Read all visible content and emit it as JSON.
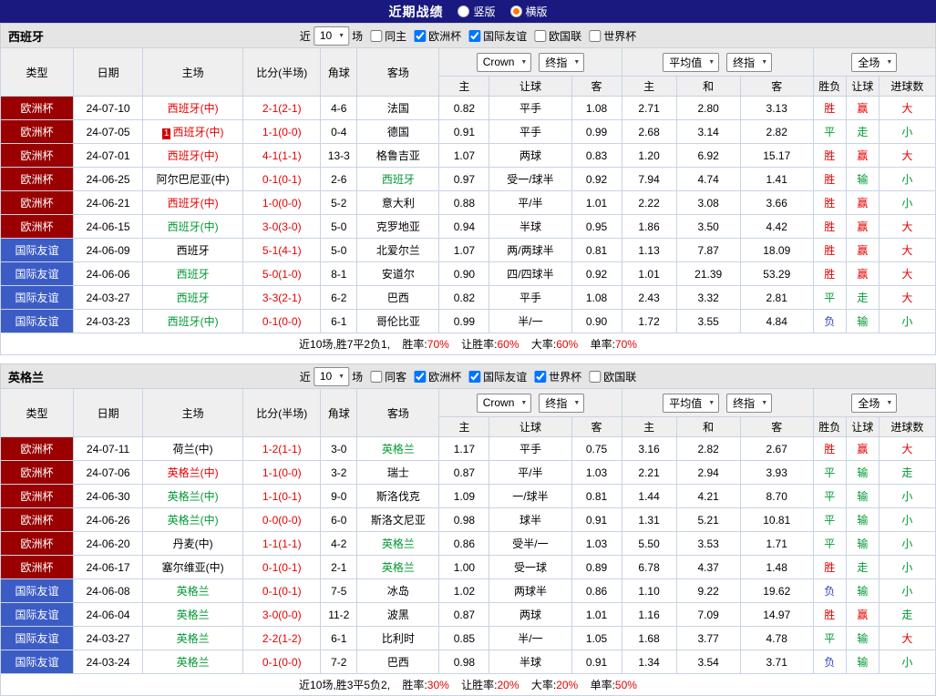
{
  "topbar": {
    "title": "近期战绩",
    "options": [
      {
        "label": "竖版",
        "selected": false
      },
      {
        "label": "横版",
        "selected": true
      }
    ]
  },
  "palette": {
    "euro_bg": "#9a0000",
    "friendly_bg": "#3c5cc5",
    "red": "#e60000",
    "green": "#009933",
    "blue": "#3344cc"
  },
  "table_header": {
    "cols": [
      "类型",
      "日期",
      "主场",
      "比分(半场)",
      "角球",
      "客场"
    ],
    "odds_selects": [
      "Crown",
      "终指"
    ],
    "avg_selects": [
      "平均值",
      "终指"
    ],
    "result_select": "全场",
    "sub": [
      "主",
      "让球",
      "客",
      "主",
      "和",
      "客",
      "胜负",
      "让球",
      "进球数"
    ]
  },
  "sections": [
    {
      "team": "西班牙",
      "filter": {
        "near": "近",
        "count": "10",
        "games": "场",
        "same": {
          "label": "同主",
          "checked": false
        },
        "leagues": [
          {
            "label": "欧洲杯",
            "checked": true
          },
          {
            "label": "国际友谊",
            "checked": true
          },
          {
            "label": "欧国联",
            "checked": false
          },
          {
            "label": "世界杯",
            "checked": false
          }
        ]
      },
      "rows": [
        {
          "type": "欧洲杯",
          "date": "24-07-10",
          "home": "西班牙(中)",
          "home_color": "red",
          "badge": "",
          "score": "2-1(2-1)",
          "corner": "4-6",
          "away": "法国",
          "away_color": "black",
          "crow": [
            "0.82",
            "平手",
            "1.08"
          ],
          "avg": [
            "2.71",
            "2.80",
            "3.13"
          ],
          "result": [
            "胜",
            "赢",
            "大"
          ],
          "result_color": [
            "red",
            "red",
            "red"
          ]
        },
        {
          "type": "欧洲杯",
          "date": "24-07-05",
          "home": "西班牙(中)",
          "home_color": "red",
          "badge": "1",
          "score": "1-1(0-0)",
          "corner": "0-4",
          "away": "德国",
          "away_color": "black",
          "crow": [
            "0.91",
            "平手",
            "0.99"
          ],
          "avg": [
            "2.68",
            "3.14",
            "2.82"
          ],
          "result": [
            "平",
            "走",
            "小"
          ],
          "result_color": [
            "green",
            "green",
            "green"
          ]
        },
        {
          "type": "欧洲杯",
          "date": "24-07-01",
          "home": "西班牙(中)",
          "home_color": "red",
          "badge": "",
          "score": "4-1(1-1)",
          "corner": "13-3",
          "away": "格鲁吉亚",
          "away_color": "black",
          "crow": [
            "1.07",
            "两球",
            "0.83"
          ],
          "avg": [
            "1.20",
            "6.92",
            "15.17"
          ],
          "result": [
            "胜",
            "赢",
            "大"
          ],
          "result_color": [
            "red",
            "red",
            "red"
          ]
        },
        {
          "type": "欧洲杯",
          "date": "24-06-25",
          "home": "阿尔巴尼亚(中)",
          "home_color": "black",
          "badge": "",
          "score": "0-1(0-1)",
          "corner": "2-6",
          "away": "西班牙",
          "away_color": "green",
          "crow": [
            "0.97",
            "受一/球半",
            "0.92"
          ],
          "avg": [
            "7.94",
            "4.74",
            "1.41"
          ],
          "result": [
            "胜",
            "输",
            "小"
          ],
          "result_color": [
            "red",
            "green",
            "green"
          ]
        },
        {
          "type": "欧洲杯",
          "date": "24-06-21",
          "home": "西班牙(中)",
          "home_color": "red",
          "badge": "",
          "score": "1-0(0-0)",
          "corner": "5-2",
          "away": "意大利",
          "away_color": "black",
          "crow": [
            "0.88",
            "平/半",
            "1.01"
          ],
          "avg": [
            "2.22",
            "3.08",
            "3.66"
          ],
          "result": [
            "胜",
            "赢",
            "小"
          ],
          "result_color": [
            "red",
            "red",
            "green"
          ]
        },
        {
          "type": "欧洲杯",
          "date": "24-06-15",
          "home": "西班牙(中)",
          "home_color": "green",
          "badge": "",
          "score": "3-0(3-0)",
          "corner": "5-0",
          "away": "克罗地亚",
          "away_color": "black",
          "crow": [
            "0.94",
            "半球",
            "0.95"
          ],
          "avg": [
            "1.86",
            "3.50",
            "4.42"
          ],
          "result": [
            "胜",
            "赢",
            "大"
          ],
          "result_color": [
            "red",
            "red",
            "red"
          ]
        },
        {
          "type": "国际友谊",
          "date": "24-06-09",
          "home": "西班牙",
          "home_color": "black",
          "badge": "",
          "score": "5-1(4-1)",
          "corner": "5-0",
          "away": "北爱尔兰",
          "away_color": "black",
          "crow": [
            "1.07",
            "两/两球半",
            "0.81"
          ],
          "avg": [
            "1.13",
            "7.87",
            "18.09"
          ],
          "result": [
            "胜",
            "赢",
            "大"
          ],
          "result_color": [
            "red",
            "red",
            "red"
          ]
        },
        {
          "type": "国际友谊",
          "date": "24-06-06",
          "home": "西班牙",
          "home_color": "green",
          "badge": "",
          "score": "5-0(1-0)",
          "corner": "8-1",
          "away": "安道尔",
          "away_color": "black",
          "crow": [
            "0.90",
            "四/四球半",
            "0.92"
          ],
          "avg": [
            "1.01",
            "21.39",
            "53.29"
          ],
          "result": [
            "胜",
            "赢",
            "大"
          ],
          "result_color": [
            "red",
            "red",
            "red"
          ]
        },
        {
          "type": "国际友谊",
          "date": "24-03-27",
          "home": "西班牙",
          "home_color": "green",
          "badge": "",
          "score": "3-3(2-1)",
          "corner": "6-2",
          "away": "巴西",
          "away_color": "black",
          "crow": [
            "0.82",
            "平手",
            "1.08"
          ],
          "avg": [
            "2.43",
            "3.32",
            "2.81"
          ],
          "result": [
            "平",
            "走",
            "大"
          ],
          "result_color": [
            "green",
            "green",
            "red"
          ]
        },
        {
          "type": "国际友谊",
          "date": "24-03-23",
          "home": "西班牙(中)",
          "home_color": "green",
          "badge": "",
          "score": "0-1(0-0)",
          "corner": "6-1",
          "away": "哥伦比亚",
          "away_color": "black",
          "crow": [
            "0.99",
            "半/一",
            "0.90"
          ],
          "avg": [
            "1.72",
            "3.55",
            "4.84"
          ],
          "result": [
            "负",
            "输",
            "小"
          ],
          "result_color": [
            "blue",
            "green",
            "green"
          ]
        }
      ],
      "summary": {
        "prefix": "近10场,胜7平2负1,",
        "stats": [
          {
            "label": "胜率:",
            "value": "70%"
          },
          {
            "label": "让胜率:",
            "value": "60%"
          },
          {
            "label": "大率:",
            "value": "60%"
          },
          {
            "label": "单率:",
            "value": "70%"
          }
        ]
      }
    },
    {
      "team": "英格兰",
      "filter": {
        "near": "近",
        "count": "10",
        "games": "场",
        "same": {
          "label": "同客",
          "checked": false
        },
        "leagues": [
          {
            "label": "欧洲杯",
            "checked": true
          },
          {
            "label": "国际友谊",
            "checked": true
          },
          {
            "label": "世界杯",
            "checked": true
          },
          {
            "label": "欧国联",
            "checked": false
          }
        ]
      },
      "rows": [
        {
          "type": "欧洲杯",
          "date": "24-07-11",
          "home": "荷兰(中)",
          "home_color": "black",
          "badge": "",
          "score": "1-2(1-1)",
          "corner": "3-0",
          "away": "英格兰",
          "away_color": "green",
          "crow": [
            "1.17",
            "平手",
            "0.75"
          ],
          "avg": [
            "3.16",
            "2.82",
            "2.67"
          ],
          "result": [
            "胜",
            "赢",
            "大"
          ],
          "result_color": [
            "red",
            "red",
            "red"
          ]
        },
        {
          "type": "欧洲杯",
          "date": "24-07-06",
          "home": "英格兰(中)",
          "home_color": "red",
          "badge": "",
          "score": "1-1(0-0)",
          "corner": "3-2",
          "away": "瑞士",
          "away_color": "black",
          "crow": [
            "0.87",
            "平/半",
            "1.03"
          ],
          "avg": [
            "2.21",
            "2.94",
            "3.93"
          ],
          "result": [
            "平",
            "输",
            "走"
          ],
          "result_color": [
            "green",
            "green",
            "green"
          ]
        },
        {
          "type": "欧洲杯",
          "date": "24-06-30",
          "home": "英格兰(中)",
          "home_color": "green",
          "badge": "",
          "score": "1-1(0-1)",
          "corner": "9-0",
          "away": "斯洛伐克",
          "away_color": "black",
          "crow": [
            "1.09",
            "一/球半",
            "0.81"
          ],
          "avg": [
            "1.44",
            "4.21",
            "8.70"
          ],
          "result": [
            "平",
            "输",
            "小"
          ],
          "result_color": [
            "green",
            "green",
            "green"
          ]
        },
        {
          "type": "欧洲杯",
          "date": "24-06-26",
          "home": "英格兰(中)",
          "home_color": "green",
          "badge": "",
          "score": "0-0(0-0)",
          "corner": "6-0",
          "away": "斯洛文尼亚",
          "away_color": "black",
          "crow": [
            "0.98",
            "球半",
            "0.91"
          ],
          "avg": [
            "1.31",
            "5.21",
            "10.81"
          ],
          "result": [
            "平",
            "输",
            "小"
          ],
          "result_color": [
            "green",
            "green",
            "green"
          ]
        },
        {
          "type": "欧洲杯",
          "date": "24-06-20",
          "home": "丹麦(中)",
          "home_color": "black",
          "badge": "",
          "score": "1-1(1-1)",
          "corner": "4-2",
          "away": "英格兰",
          "away_color": "green",
          "crow": [
            "0.86",
            "受半/一",
            "1.03"
          ],
          "avg": [
            "5.50",
            "3.53",
            "1.71"
          ],
          "result": [
            "平",
            "输",
            "小"
          ],
          "result_color": [
            "green",
            "green",
            "green"
          ]
        },
        {
          "type": "欧洲杯",
          "date": "24-06-17",
          "home": "塞尔维亚(中)",
          "home_color": "black",
          "badge": "",
          "score": "0-1(0-1)",
          "corner": "2-1",
          "away": "英格兰",
          "away_color": "green",
          "crow": [
            "1.00",
            "受一球",
            "0.89"
          ],
          "avg": [
            "6.78",
            "4.37",
            "1.48"
          ],
          "result": [
            "胜",
            "走",
            "小"
          ],
          "result_color": [
            "red",
            "green",
            "green"
          ]
        },
        {
          "type": "国际友谊",
          "date": "24-06-08",
          "home": "英格兰",
          "home_color": "green",
          "badge": "",
          "score": "0-1(0-1)",
          "corner": "7-5",
          "away": "冰岛",
          "away_color": "black",
          "crow": [
            "1.02",
            "两球半",
            "0.86"
          ],
          "avg": [
            "1.10",
            "9.22",
            "19.62"
          ],
          "result": [
            "负",
            "输",
            "小"
          ],
          "result_color": [
            "blue",
            "green",
            "green"
          ]
        },
        {
          "type": "国际友谊",
          "date": "24-06-04",
          "home": "英格兰",
          "home_color": "green",
          "badge": "",
          "score": "3-0(0-0)",
          "corner": "11-2",
          "away": "波黑",
          "away_color": "black",
          "crow": [
            "0.87",
            "两球",
            "1.01"
          ],
          "avg": [
            "1.16",
            "7.09",
            "14.97"
          ],
          "result": [
            "胜",
            "赢",
            "走"
          ],
          "result_color": [
            "red",
            "red",
            "green"
          ]
        },
        {
          "type": "国际友谊",
          "date": "24-03-27",
          "home": "英格兰",
          "home_color": "green",
          "badge": "",
          "score": "2-2(1-2)",
          "corner": "6-1",
          "away": "比利时",
          "away_color": "black",
          "crow": [
            "0.85",
            "半/一",
            "1.05"
          ],
          "avg": [
            "1.68",
            "3.77",
            "4.78"
          ],
          "result": [
            "平",
            "输",
            "大"
          ],
          "result_color": [
            "green",
            "green",
            "red"
          ]
        },
        {
          "type": "国际友谊",
          "date": "24-03-24",
          "home": "英格兰",
          "home_color": "green",
          "badge": "",
          "score": "0-1(0-0)",
          "corner": "7-2",
          "away": "巴西",
          "away_color": "black",
          "crow": [
            "0.98",
            "半球",
            "0.91"
          ],
          "avg": [
            "1.34",
            "3.54",
            "3.71"
          ],
          "result": [
            "负",
            "输",
            "小"
          ],
          "result_color": [
            "blue",
            "green",
            "green"
          ]
        }
      ],
      "summary": {
        "prefix": "近10场,胜3平5负2,",
        "stats": [
          {
            "label": "胜率:",
            "value": "30%"
          },
          {
            "label": "让胜率:",
            "value": "20%"
          },
          {
            "label": "大率:",
            "value": "20%"
          },
          {
            "label": "单率:",
            "value": "50%"
          }
        ]
      }
    }
  ]
}
